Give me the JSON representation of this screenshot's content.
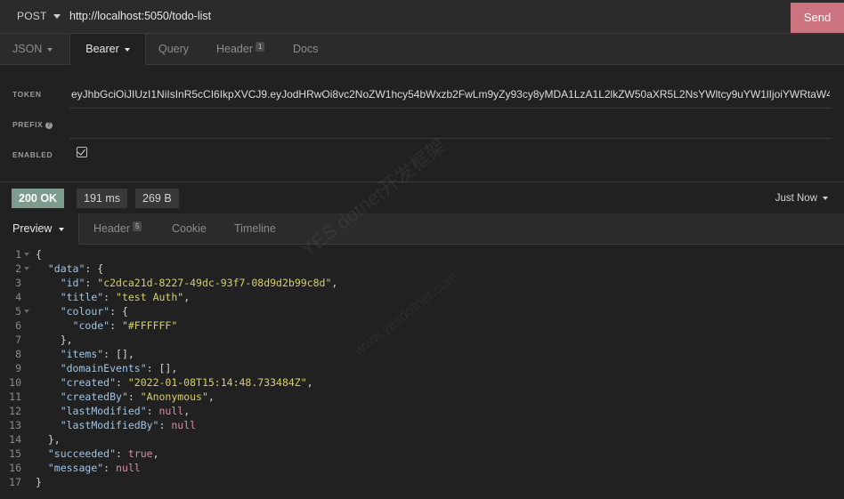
{
  "request": {
    "method": "POST",
    "url": "http://localhost:5050/todo-list",
    "send_label": "Send",
    "tabs": [
      {
        "label": "JSON"
      },
      {
        "label": "Bearer"
      },
      {
        "label": "Query"
      },
      {
        "label": "Header",
        "badge": "1"
      },
      {
        "label": "Docs"
      }
    ]
  },
  "auth": {
    "token_label": "TOKEN",
    "token_value": "eyJhbGciOiJIUzI1NiIsInR5cCI6IkpXVCJ9.eyJodHRwOi8vc2NoZW1hcy54bWxzb2FwLm9yZy93cy8yMDA1LzA1L2lkZW50aXR5L2NsYWltcy9uYW1lIjoiYWRtaW4i",
    "prefix_label": "PREFIX",
    "enabled_label": "ENABLED",
    "enabled": true
  },
  "response": {
    "status": "200 OK",
    "time": "191 ms",
    "size": "269 B",
    "history": "Just Now",
    "tabs": [
      {
        "label": "Preview"
      },
      {
        "label": "Header",
        "badge": "5"
      },
      {
        "label": "Cookie"
      },
      {
        "label": "Timeline"
      }
    ]
  },
  "body_lines": [
    {
      "n": "1",
      "fold": true,
      "parts": [
        {
          "t": "{",
          "c": "p"
        }
      ]
    },
    {
      "n": "2",
      "fold": true,
      "parts": [
        {
          "t": "  ",
          "c": "p"
        },
        {
          "t": "\"data\"",
          "c": "k"
        },
        {
          "t": ": {",
          "c": "p"
        }
      ]
    },
    {
      "n": "3",
      "parts": [
        {
          "t": "    ",
          "c": "p"
        },
        {
          "t": "\"id\"",
          "c": "k"
        },
        {
          "t": ": ",
          "c": "p"
        },
        {
          "t": "\"c2dca21d-8227-49dc-93f7-08d9d2b99c8d\"",
          "c": "s"
        },
        {
          "t": ",",
          "c": "p"
        }
      ]
    },
    {
      "n": "4",
      "parts": [
        {
          "t": "    ",
          "c": "p"
        },
        {
          "t": "\"title\"",
          "c": "k"
        },
        {
          "t": ": ",
          "c": "p"
        },
        {
          "t": "\"test Auth\"",
          "c": "s"
        },
        {
          "t": ",",
          "c": "p"
        }
      ]
    },
    {
      "n": "5",
      "fold": true,
      "parts": [
        {
          "t": "    ",
          "c": "p"
        },
        {
          "t": "\"colour\"",
          "c": "k"
        },
        {
          "t": ": {",
          "c": "p"
        }
      ]
    },
    {
      "n": "6",
      "parts": [
        {
          "t": "      ",
          "c": "p"
        },
        {
          "t": "\"code\"",
          "c": "k"
        },
        {
          "t": ": ",
          "c": "p"
        },
        {
          "t": "\"#FFFFFF\"",
          "c": "s"
        }
      ]
    },
    {
      "n": "7",
      "parts": [
        {
          "t": "    },",
          "c": "p"
        }
      ]
    },
    {
      "n": "8",
      "parts": [
        {
          "t": "    ",
          "c": "p"
        },
        {
          "t": "\"items\"",
          "c": "k"
        },
        {
          "t": ": [],",
          "c": "p"
        }
      ]
    },
    {
      "n": "9",
      "parts": [
        {
          "t": "    ",
          "c": "p"
        },
        {
          "t": "\"domainEvents\"",
          "c": "k"
        },
        {
          "t": ": [],",
          "c": "p"
        }
      ]
    },
    {
      "n": "10",
      "parts": [
        {
          "t": "    ",
          "c": "p"
        },
        {
          "t": "\"created\"",
          "c": "k"
        },
        {
          "t": ": ",
          "c": "p"
        },
        {
          "t": "\"2022-01-08T15:14:48.733484Z\"",
          "c": "s"
        },
        {
          "t": ",",
          "c": "p"
        }
      ]
    },
    {
      "n": "11",
      "parts": [
        {
          "t": "    ",
          "c": "p"
        },
        {
          "t": "\"createdBy\"",
          "c": "k"
        },
        {
          "t": ": ",
          "c": "p"
        },
        {
          "t": "\"Anonymous\"",
          "c": "s"
        },
        {
          "t": ",",
          "c": "p"
        }
      ]
    },
    {
      "n": "12",
      "parts": [
        {
          "t": "    ",
          "c": "p"
        },
        {
          "t": "\"lastModified\"",
          "c": "k"
        },
        {
          "t": ": ",
          "c": "p"
        },
        {
          "t": "null",
          "c": "lit"
        },
        {
          "t": ",",
          "c": "p"
        }
      ]
    },
    {
      "n": "13",
      "parts": [
        {
          "t": "    ",
          "c": "p"
        },
        {
          "t": "\"lastModifiedBy\"",
          "c": "k"
        },
        {
          "t": ": ",
          "c": "p"
        },
        {
          "t": "null",
          "c": "lit"
        }
      ]
    },
    {
      "n": "14",
      "parts": [
        {
          "t": "  },",
          "c": "p"
        }
      ]
    },
    {
      "n": "15",
      "parts": [
        {
          "t": "  ",
          "c": "p"
        },
        {
          "t": "\"succeeded\"",
          "c": "k"
        },
        {
          "t": ": ",
          "c": "p"
        },
        {
          "t": "true",
          "c": "lit"
        },
        {
          "t": ",",
          "c": "p"
        }
      ]
    },
    {
      "n": "16",
      "parts": [
        {
          "t": "  ",
          "c": "p"
        },
        {
          "t": "\"message\"",
          "c": "k"
        },
        {
          "t": ": ",
          "c": "p"
        },
        {
          "t": "null",
          "c": "lit"
        }
      ]
    },
    {
      "n": "17",
      "parts": [
        {
          "t": "}",
          "c": "p"
        }
      ]
    }
  ],
  "watermark": {
    "line1": "YES dotnet开发框架",
    "line2": "www.yesdotnet.com"
  },
  "colors": {
    "send": "#cb7480",
    "status_ok": "#7d9c8d",
    "json_key": "#9fc4e3",
    "json_string": "#d6cf6b",
    "json_literal": "#d98ba8"
  }
}
